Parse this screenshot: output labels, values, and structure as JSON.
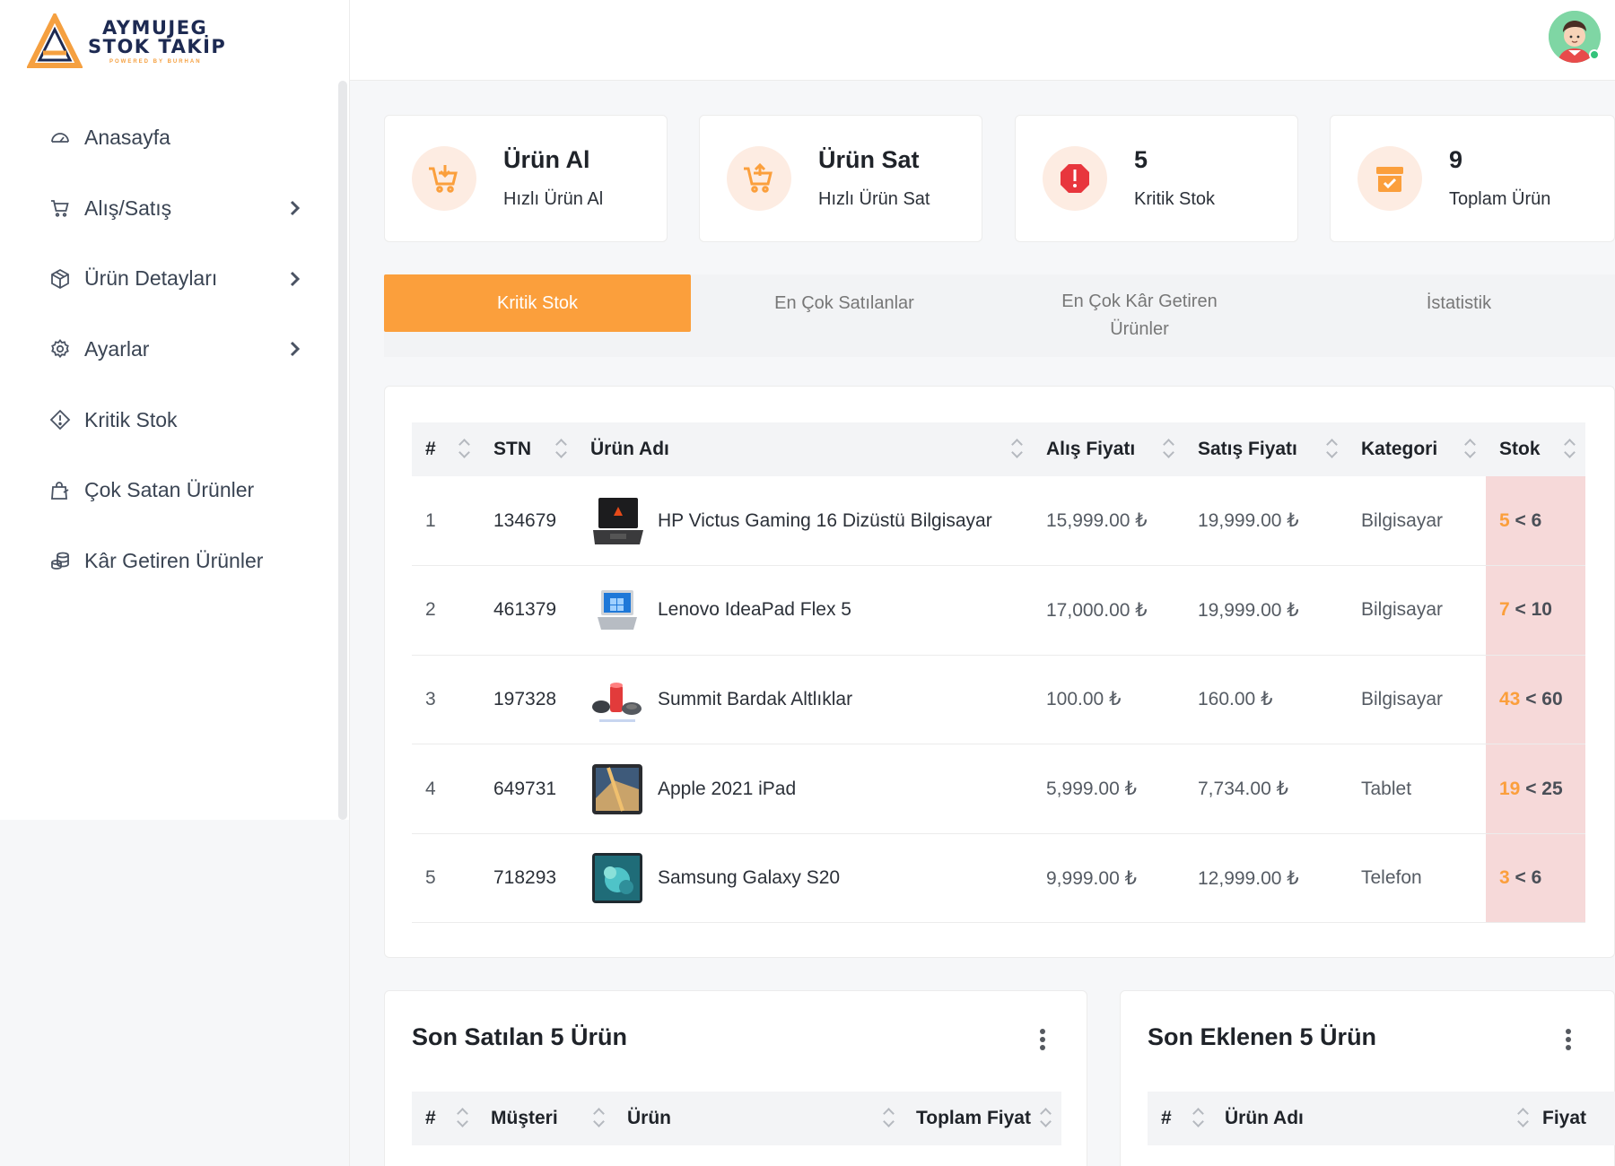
{
  "brand": {
    "line1": "AYMUJEG",
    "line2": "STOK TAKİP",
    "line3": "POWERED BY BURHAN",
    "accent": "#fb9f3c"
  },
  "sidebar": {
    "items": [
      {
        "label": "Anasayfa",
        "icon": "dashboard-icon",
        "has_submenu": false
      },
      {
        "label": "Alış/Satış",
        "icon": "cart-icon",
        "has_submenu": true
      },
      {
        "label": "Ürün Detayları",
        "icon": "box-icon",
        "has_submenu": true
      },
      {
        "label": "Ayarlar",
        "icon": "gear-icon",
        "has_submenu": true
      },
      {
        "label": "Kritik Stok",
        "icon": "warning-diamond-icon",
        "has_submenu": false
      },
      {
        "label": "Çok Satan Ürünler",
        "icon": "shopping-bag-icon",
        "has_submenu": false
      },
      {
        "label": "Kâr Getiren Ürünler",
        "icon": "coins-icon",
        "has_submenu": false
      }
    ]
  },
  "cards": [
    {
      "title": "Ürün Al",
      "subtitle": "Hızlı Ürün Al",
      "icon": "cart-download-icon"
    },
    {
      "title": "Ürün Sat",
      "subtitle": "Hızlı Ürün Sat",
      "icon": "cart-upload-icon"
    },
    {
      "title": "5",
      "subtitle": "Kritik Stok",
      "icon": "alert-octagon-icon"
    },
    {
      "title": "9",
      "subtitle": "Toplam Ürün",
      "icon": "archive-check-icon"
    }
  ],
  "tabs": [
    {
      "label": "Kritik Stok",
      "active": true
    },
    {
      "label": "En Çok Satılanlar",
      "active": false
    },
    {
      "label": "En Çok Kâr Getiren Ürünler",
      "active": false
    },
    {
      "label": "İstatistik",
      "active": false
    }
  ],
  "critical_table": {
    "headers": {
      "num": "#",
      "stn": "STN",
      "name": "Ürün Adı",
      "buy": "Alış Fiyatı",
      "sell": "Satış Fiyatı",
      "category": "Kategori",
      "stock": "Stok"
    },
    "rows": [
      {
        "num": "1",
        "stn": "134679",
        "name": "HP Victus Gaming 16 Dizüstü Bilgisayar",
        "buy": "15,999.00 ₺",
        "sell": "19,999.00 ₺",
        "category": "Bilgisayar",
        "stock": "5",
        "limit": "< 6",
        "thumb": "laptop-dark"
      },
      {
        "num": "2",
        "stn": "461379",
        "name": "Lenovo IdeaPad Flex 5",
        "buy": "17,000.00 ₺",
        "sell": "19,999.00 ₺",
        "category": "Bilgisayar",
        "stock": "7",
        "limit": "< 10",
        "thumb": "laptop-silver"
      },
      {
        "num": "3",
        "stn": "197328",
        "name": "Summit Bardak Altlıklar",
        "buy": "100.00 ₺",
        "sell": "160.00 ₺",
        "category": "Bilgisayar",
        "stock": "43",
        "limit": "< 60",
        "thumb": "coasters"
      },
      {
        "num": "4",
        "stn": "649731",
        "name": "Apple 2021 iPad",
        "buy": "5,999.00 ₺",
        "sell": "7,734.00 ₺",
        "category": "Tablet",
        "stock": "19",
        "limit": "< 25",
        "thumb": "tablet"
      },
      {
        "num": "5",
        "stn": "718293",
        "name": "Samsung Galaxy S20",
        "buy": "9,999.00 ₺",
        "sell": "12,999.00 ₺",
        "category": "Telefon",
        "stock": "3",
        "limit": "< 6",
        "thumb": "phone"
      }
    ]
  },
  "recent_sold": {
    "title": "Son Satılan 5 Ürün",
    "headers": {
      "num": "#",
      "customer": "Müşteri",
      "product": "Ürün",
      "total": "Toplam Fiyat"
    }
  },
  "recent_added": {
    "title": "Son Eklenen 5 Ürün",
    "headers": {
      "num": "#",
      "name": "Ürün Adı",
      "price": "Fiyat"
    }
  }
}
